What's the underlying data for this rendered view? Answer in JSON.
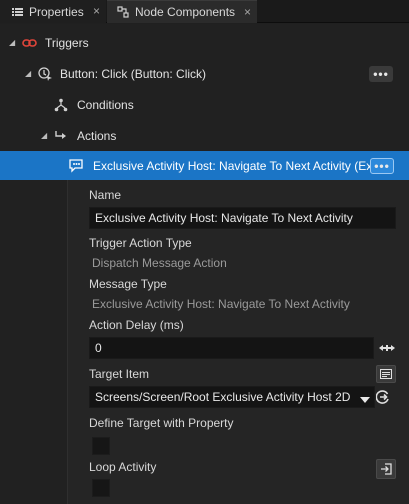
{
  "tabs": [
    {
      "label": "Properties",
      "icon": "list-icon",
      "active": false,
      "close": "×"
    },
    {
      "label": "Node Components",
      "icon": "node-components-icon",
      "active": true,
      "close": "×"
    }
  ],
  "tree": {
    "triggers": {
      "label": "Triggers",
      "icon": "trigger-icon"
    },
    "button_click": {
      "label": "Button: Click (Button: Click)",
      "icon": "button-click-icon",
      "menu": "•••"
    },
    "conditions": {
      "label": "Conditions",
      "icon": "conditions-icon"
    },
    "actions": {
      "label": "Actions",
      "icon": "actions-icon"
    },
    "selected_action": {
      "label": "Exclusive Activity Host: Navigate To Next Activity (Exclusive Activity Host: Navigate To Next Activity)",
      "icon": "message-action-icon",
      "menu": "•••"
    }
  },
  "properties": {
    "name": {
      "label": "Name",
      "value": "Exclusive Activity Host: Navigate To Next Activity"
    },
    "trigger_action_type": {
      "label": "Trigger Action Type",
      "value": "Dispatch Message Action"
    },
    "message_type": {
      "label": "Message Type",
      "value": "Exclusive Activity Host: Navigate To Next Activity"
    },
    "action_delay": {
      "label": "Action Delay (ms)",
      "value": "0"
    },
    "target_item": {
      "label": "Target Item",
      "value": "Screens/Screen/Root Exclusive Activity Host 2D"
    },
    "define_target": {
      "label": "Define Target with Property",
      "checked": false
    },
    "loop_activity": {
      "label": "Loop Activity",
      "checked": false
    }
  }
}
